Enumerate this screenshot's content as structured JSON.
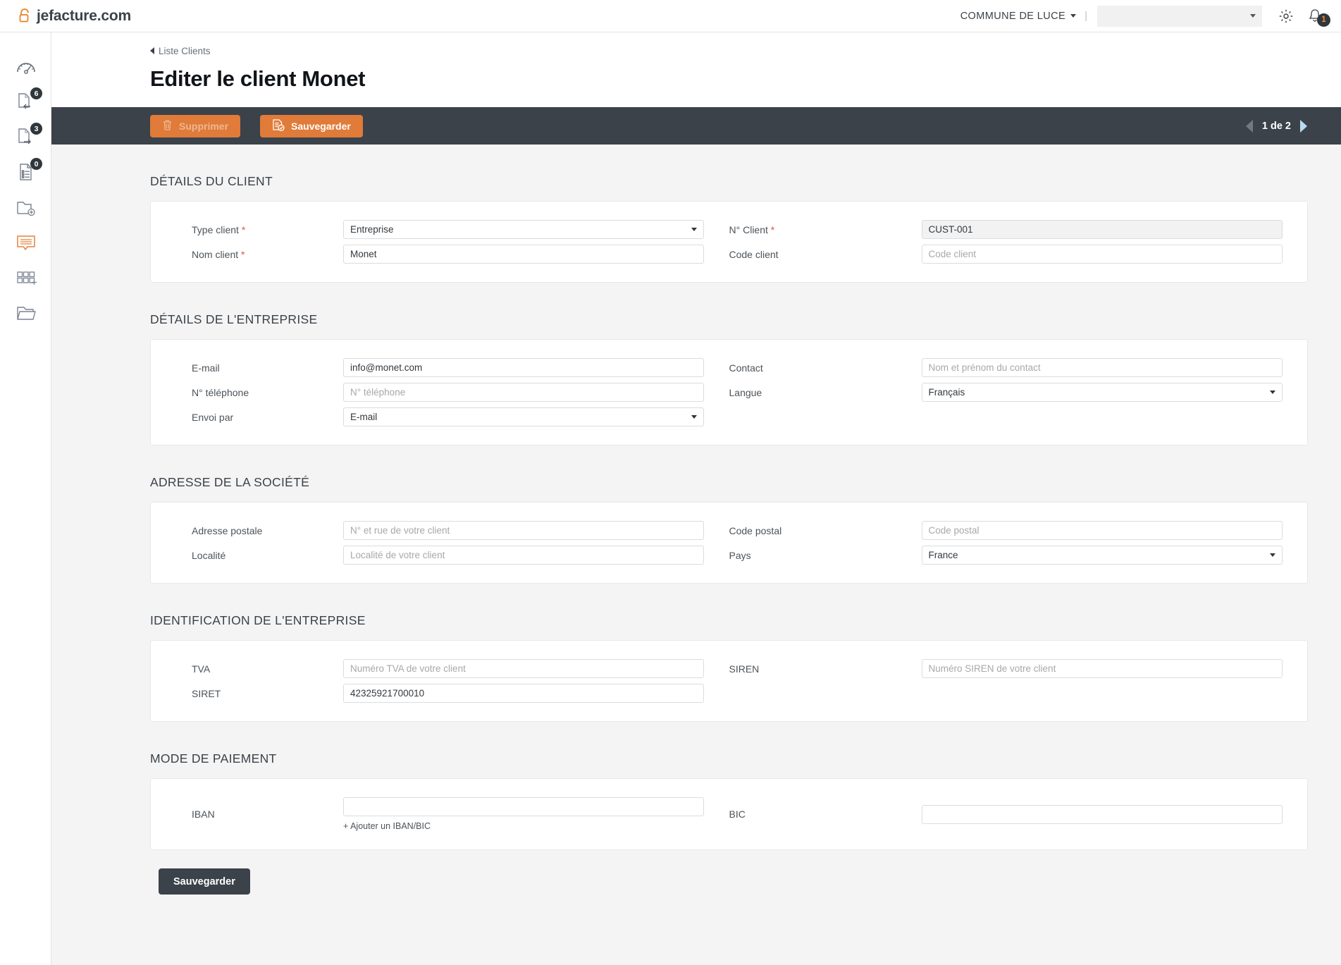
{
  "brand": {
    "name": "jefacture.com",
    "icon": "lock-icon",
    "accent": "#e8811f"
  },
  "topbar": {
    "org_name": "COMMUNE DE LUCE",
    "separator": "|",
    "org_select_value": "",
    "gear_icon": "gear-icon",
    "bell_icon": "bell-icon",
    "notification_count": "1"
  },
  "sidebar": {
    "items": [
      {
        "icon": "dashboard-gauge-icon",
        "badge": null,
        "active": false
      },
      {
        "icon": "document-incoming-icon",
        "badge": "6",
        "active": false
      },
      {
        "icon": "document-outgoing-icon",
        "badge": "3",
        "active": false
      },
      {
        "icon": "document-list-icon",
        "badge": "0",
        "active": false
      },
      {
        "icon": "folder-add-icon",
        "badge": null,
        "active": false
      },
      {
        "icon": "message-bubble-icon",
        "badge": null,
        "active": true
      },
      {
        "icon": "grid-add-icon",
        "badge": null,
        "active": false
      },
      {
        "icon": "folder-open-icon",
        "badge": null,
        "active": false
      }
    ]
  },
  "page": {
    "breadcrumb": "Liste Clients",
    "title": "Editer le client Monet"
  },
  "actionbar": {
    "delete_label": "Supprimer",
    "delete_icon": "trash-icon",
    "delete_disabled": true,
    "save_label": "Sauvegarder",
    "save_icon": "save-document-icon",
    "pagination": "1 de 2",
    "prev_icon": "chevron-left-icon",
    "next_icon": "chevron-right-icon"
  },
  "sections": {
    "client_details": {
      "title": "DÉTAILS DU CLIENT",
      "type_client": {
        "label": "Type client",
        "required": true,
        "value": "Entreprise"
      },
      "num_client": {
        "label": "N° Client",
        "required": true,
        "value": "CUST-001"
      },
      "nom_client": {
        "label": "Nom client",
        "required": true,
        "value": "Monet"
      },
      "code_client": {
        "label": "Code client",
        "placeholder": "Code client",
        "value": ""
      }
    },
    "company_details": {
      "title": "DÉTAILS DE L'ENTREPRISE",
      "email": {
        "label": "E-mail",
        "value": "info@monet.com"
      },
      "contact": {
        "label": "Contact",
        "placeholder": "Nom et prénom du contact",
        "value": ""
      },
      "telephone": {
        "label": "N° téléphone",
        "placeholder": "N° téléphone",
        "value": ""
      },
      "langue": {
        "label": "Langue",
        "value": "Français"
      },
      "envoi_par": {
        "label": "Envoi par",
        "value": "E-mail"
      }
    },
    "company_address": {
      "title": "ADRESSE DE LA SOCIÉTÉ",
      "adresse_postale": {
        "label": "Adresse postale",
        "placeholder": "N° et rue de votre client",
        "value": ""
      },
      "code_postal": {
        "label": "Code postal",
        "placeholder": "Code postal",
        "value": ""
      },
      "localite": {
        "label": "Localité",
        "placeholder": "Localité de votre client",
        "value": ""
      },
      "pays": {
        "label": "Pays",
        "value": "France"
      }
    },
    "company_identification": {
      "title": "IDENTIFICATION DE L'ENTREPRISE",
      "tva": {
        "label": "TVA",
        "placeholder": "Numéro TVA de votre client",
        "value": ""
      },
      "siren": {
        "label": "SIREN",
        "placeholder": "Numéro SIREN de votre client",
        "value": ""
      },
      "siret": {
        "label": "SIRET",
        "value": "42325921700010"
      }
    },
    "payment_mode": {
      "title": "MODE DE PAIEMENT",
      "iban": {
        "label": "IBAN",
        "placeholder": "",
        "value": ""
      },
      "bic": {
        "label": "BIC",
        "placeholder": "",
        "value": ""
      },
      "add_link": "+ Ajouter un IBAN/BIC"
    }
  },
  "footer": {
    "save_label": "Sauvegarder"
  },
  "colors": {
    "accent_orange": "#e07b39",
    "dark_bar": "#3b4249",
    "page_bg": "#f4f4f4",
    "next_arrow_blue": "#b9dcf2"
  }
}
